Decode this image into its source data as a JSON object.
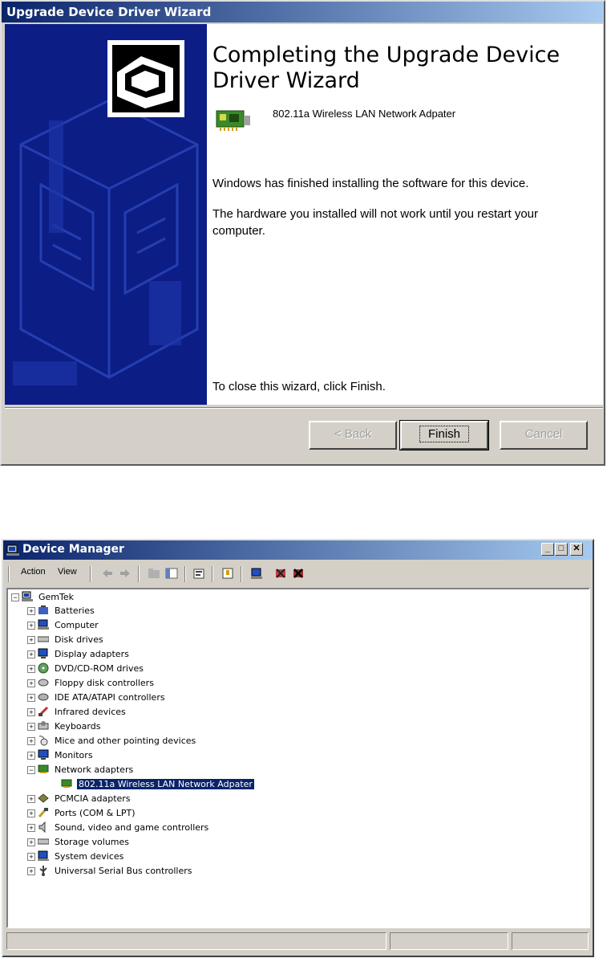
{
  "wizard": {
    "window_title": "Upgrade Device Driver Wizard",
    "heading": "Completing the Upgrade Device Driver Wizard",
    "device_name": "802.11a Wireless LAN Network Adpater",
    "message_1": "Windows has finished installing the software for this device.",
    "message_2": "The hardware you installed will not work until you restart your computer.",
    "close_hint": "To close this wizard, click Finish.",
    "buttons": {
      "back": "< Back",
      "finish": "Finish",
      "cancel": "Cancel"
    }
  },
  "device_manager": {
    "window_title": "Device Manager",
    "menu": {
      "action": "Action",
      "view": "View"
    },
    "tree_root": "GemTek",
    "categories": [
      "Batteries",
      "Computer",
      "Disk drives",
      "Display adapters",
      "DVD/CD-ROM drives",
      "Floppy disk controllers",
      "IDE ATA/ATAPI controllers",
      "Infrared devices",
      "Keyboards",
      "Mice and other pointing devices",
      "Monitors",
      "Network adapters",
      "802.11a Wireless LAN Network Adpater",
      "PCMCIA adapters",
      "Ports (COM & LPT)",
      "Sound, video and game controllers",
      "Storage volumes",
      "System devices",
      "Universal Serial Bus controllers"
    ]
  },
  "colors": {
    "titlebar": "#0a246a",
    "banner": "#0c1d86",
    "selection": "#0a246a",
    "face": "#d4d0c8"
  }
}
